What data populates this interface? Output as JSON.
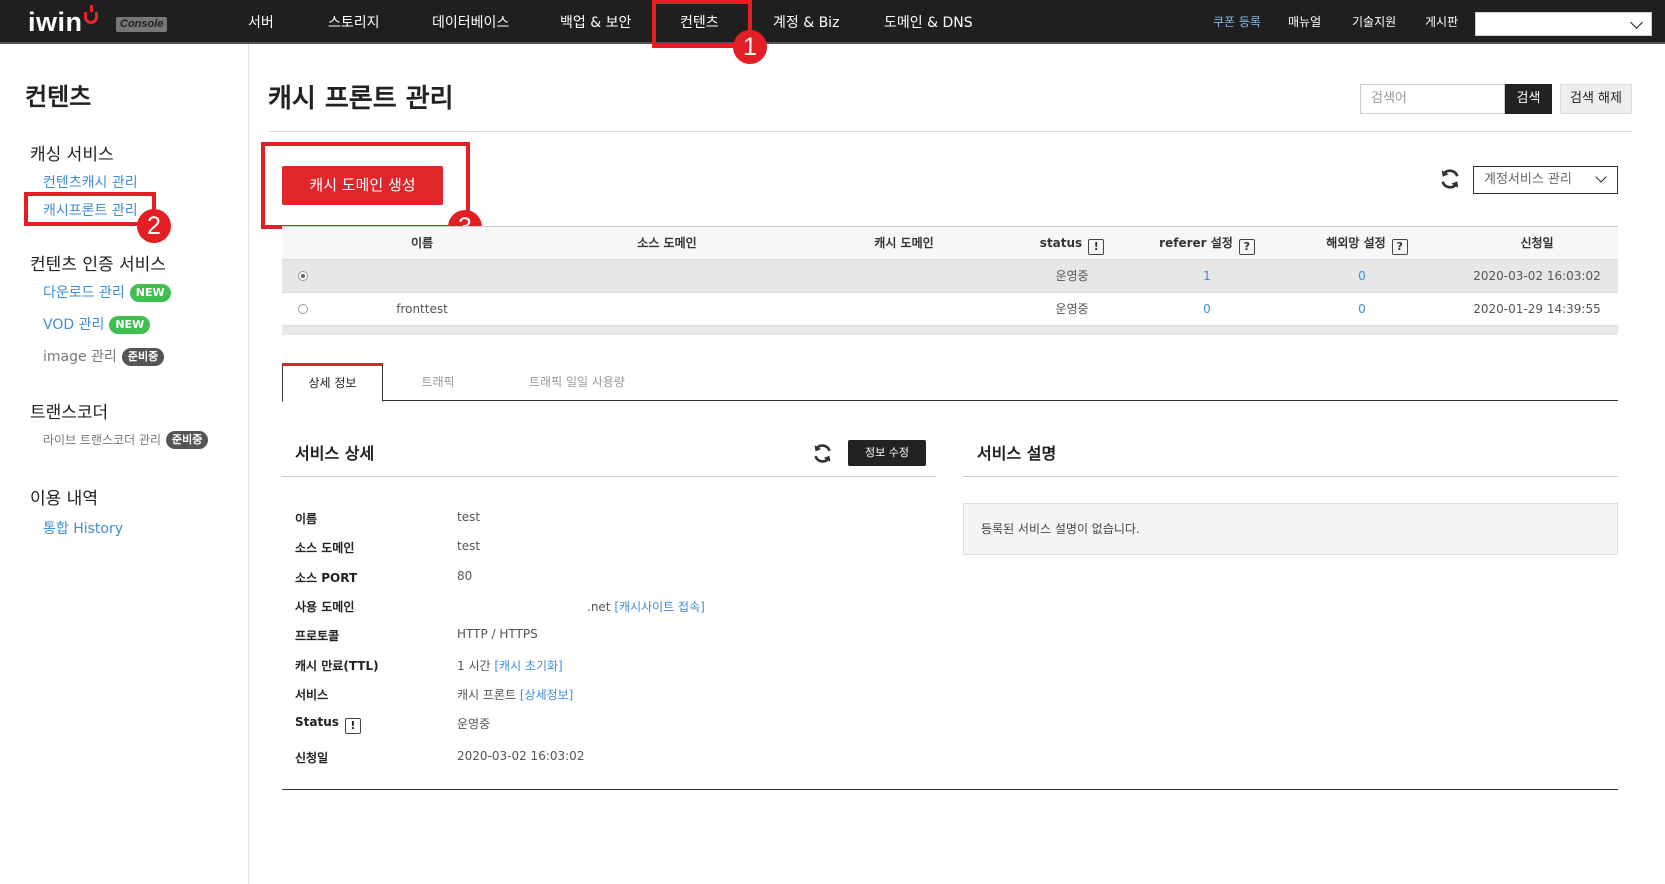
{
  "topbar": {
    "logo": "iwinv",
    "logo_badge": "Console",
    "nav": [
      "서버",
      "스토리지",
      "데이터베이스",
      "백업 & 보안",
      "컨텐츠",
      "계정 & Biz",
      "도메인 & DNS"
    ],
    "right_links": [
      "쿠폰 등록",
      "매뉴얼",
      "기술지원",
      "게시판"
    ]
  },
  "markers": [
    "1",
    "2",
    "3"
  ],
  "sidebar": {
    "title": "컨텐츠",
    "groups": [
      {
        "heading": "캐싱 서비스",
        "items": [
          {
            "label": "컨텐츠캐시 관리"
          },
          {
            "label": "캐시프론트 관리"
          }
        ]
      },
      {
        "heading": "컨텐츠 인증 서비스",
        "items": [
          {
            "label": "다운로드 관리",
            "badge": "NEW"
          },
          {
            "label": "VOD 관리",
            "badge": "NEW"
          },
          {
            "label": "image 관리",
            "badge": "준비중"
          }
        ]
      },
      {
        "heading": "트랜스코더",
        "items": [
          {
            "label": "라이브 트랜스코더 관리",
            "badge": "준비중"
          }
        ]
      },
      {
        "heading": "이용 내역",
        "items": [
          {
            "label": "통합 History"
          }
        ]
      }
    ]
  },
  "main": {
    "title": "캐시 프론트 관리",
    "search_placeholder": "검색어",
    "search_label": "검색",
    "clear_label": "검색 해제",
    "create_label": "캐시 도메인 생성",
    "account_select": "계정서비스 관리"
  },
  "table": {
    "headers": [
      "이름",
      "소스 도메인",
      "캐시 도메인",
      "status",
      "referer 설정",
      "해외망 설정",
      "신청일"
    ],
    "rows": [
      {
        "name": "",
        "source": "",
        "cache": "",
        "status": "운영중",
        "referer": "1",
        "overseas": "0",
        "date": "2020-03-02 16:03:02"
      },
      {
        "name": "fronttest",
        "source": "",
        "cache": "",
        "status": "운영중",
        "referer": "0",
        "overseas": "0",
        "date": "2020-01-29 14:39:55"
      }
    ]
  },
  "tabs": [
    "상세 정보",
    "트래픽",
    "트래픽 일일 사용량"
  ],
  "detail": {
    "title": "서비스 상세",
    "edit_label": "정보 수정",
    "fields": [
      {
        "label": "이름",
        "value": "test"
      },
      {
        "label": "소스 도메인",
        "value": "test"
      },
      {
        "label": "소스 PORT",
        "value": "80"
      },
      {
        "label": "사용 도메인",
        "value": ".net",
        "link": "[캐시사이트 접속]"
      },
      {
        "label": "프로토콜",
        "value": "HTTP / HTTPS"
      },
      {
        "label": "캐시 만료(TTL)",
        "value": "1 시간",
        "link": "[캐시 초기화]"
      },
      {
        "label": "서비스",
        "value": "캐시 프론트",
        "link": "[상세정보]"
      },
      {
        "label": "Status",
        "value": "운영중"
      },
      {
        "label": "신청일",
        "value": "2020-03-02 16:03:02"
      }
    ]
  },
  "description": {
    "title": "서비스 설명",
    "text": "등록된 서비스 설명이 없습니다."
  },
  "colors": {
    "accent": "#e0262b",
    "link": "#3f8ed8",
    "topbar": "#1f1f1f",
    "badge_new": "#3fbf4f"
  }
}
